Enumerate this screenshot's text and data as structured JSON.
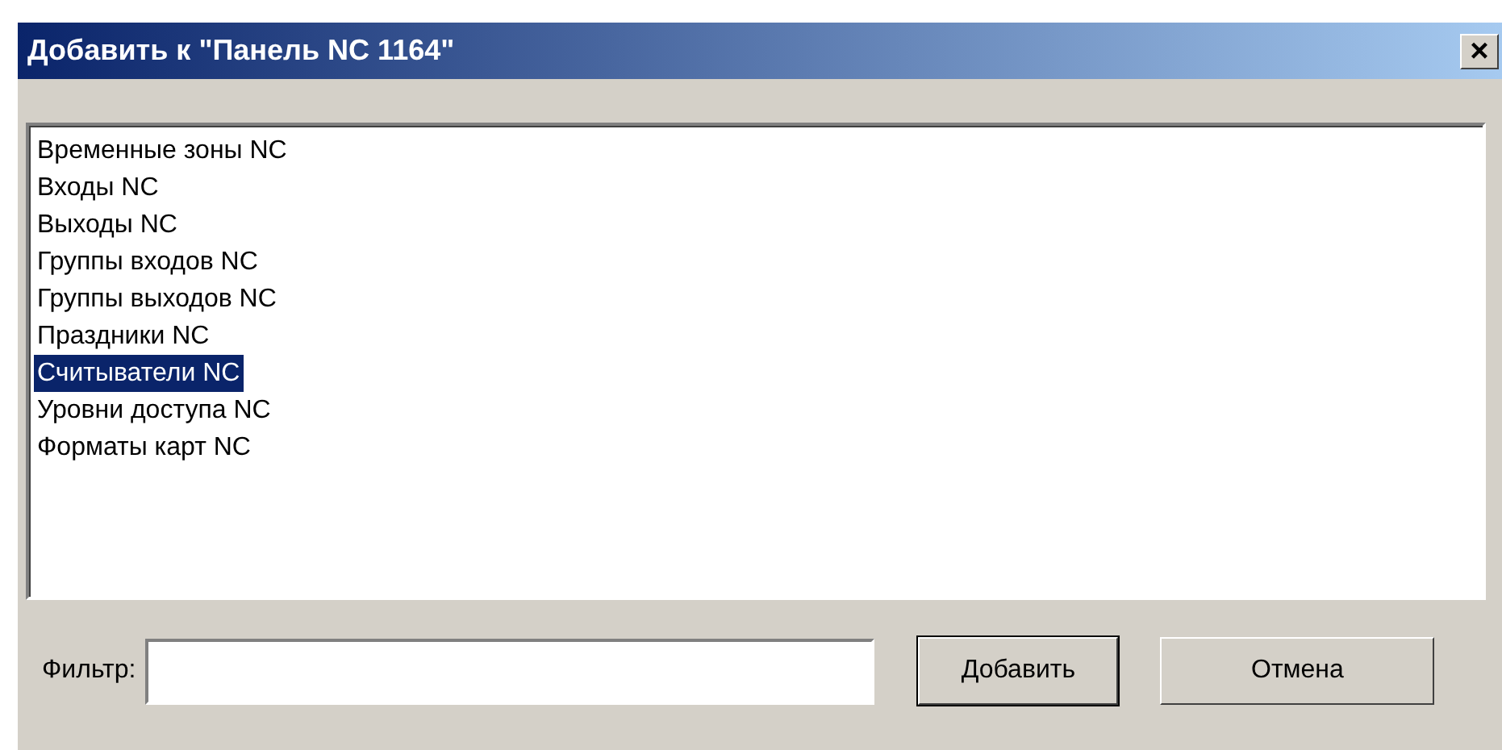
{
  "window": {
    "title": "Добавить к \"Панель NC 1164\"",
    "close": "×"
  },
  "list": {
    "items": [
      {
        "label": "Временные зоны NC",
        "selected": false
      },
      {
        "label": "Входы NC",
        "selected": false
      },
      {
        "label": "Выходы NC",
        "selected": false
      },
      {
        "label": "Группы входов NC",
        "selected": false
      },
      {
        "label": "Группы выходов NC",
        "selected": false
      },
      {
        "label": "Праздники NC",
        "selected": false
      },
      {
        "label": "Считыватели NC",
        "selected": true
      },
      {
        "label": "Уровни доступа NC",
        "selected": false
      },
      {
        "label": "Форматы карт NC",
        "selected": false
      }
    ]
  },
  "filter": {
    "label": "Фильтр:"
  },
  "buttons": [
    {
      "label": "Добавить",
      "default": true
    },
    {
      "label": "Отмена",
      "default": false
    }
  ]
}
